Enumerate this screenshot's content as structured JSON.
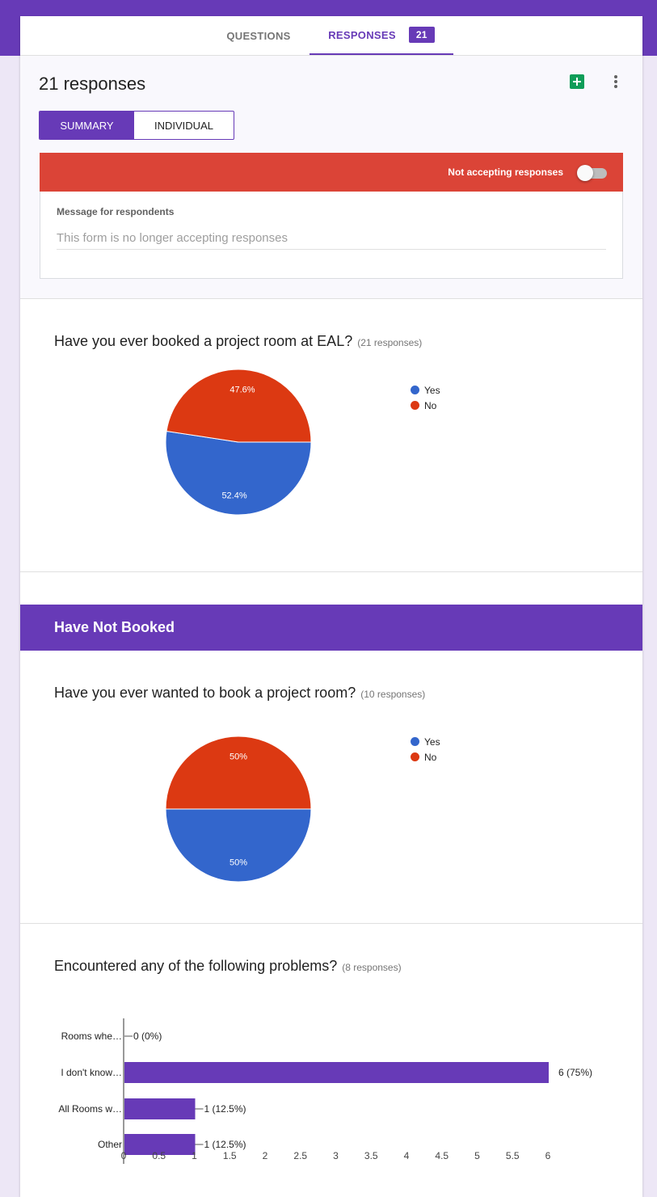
{
  "tabs": {
    "questions": "QUESTIONS",
    "responses": "RESPONSES",
    "responses_count": "21"
  },
  "summary": {
    "title": "21 responses",
    "view_summary": "SUMMARY",
    "view_individual": "INDIVIDUAL",
    "accepting_label": "Not accepting responses",
    "accepting": false,
    "message_label": "Message for respondents",
    "message_value": "This form is no longer accepting responses"
  },
  "colors": {
    "primary": "#673ab7",
    "banner": "#db4437",
    "yes": "#3366cc",
    "no": "#dc3912",
    "sheets": "#0f9d58"
  },
  "icons": {
    "sheets": "sheets-icon",
    "more": "more-vert-icon"
  },
  "section": {
    "title": "Have Not Booked"
  },
  "questions": [
    {
      "title": "Have you ever booked a project room at EAL?",
      "count": "(21 responses)"
    },
    {
      "title": "Have you ever wanted to book a project room?",
      "count": "(10 responses)"
    },
    {
      "title": "Encountered any of the following problems?",
      "count": "(8 responses)"
    }
  ],
  "chart_data": [
    {
      "type": "pie",
      "categories": [
        "Yes",
        "No"
      ],
      "values": [
        52.4,
        47.6
      ],
      "labels": [
        "52.4%",
        "47.6%"
      ],
      "legend": "right"
    },
    {
      "type": "pie",
      "categories": [
        "Yes",
        "No"
      ],
      "values": [
        50,
        50
      ],
      "labels": [
        "50%",
        "50%"
      ],
      "legend": "right"
    },
    {
      "type": "bar",
      "orientation": "horizontal",
      "categories": [
        "Rooms whe…",
        "I don't know…",
        "All Rooms w…",
        "Other"
      ],
      "values": [
        0,
        6,
        1,
        1
      ],
      "labels": [
        "0 (0%)",
        "6 (75%)",
        "1 (12.5%)",
        "1 (12.5%)"
      ],
      "xlim": [
        0,
        6
      ],
      "ticks": [
        "0",
        "0.5",
        "1",
        "1.5",
        "2",
        "2.5",
        "3",
        "3.5",
        "4",
        "4.5",
        "5",
        "5.5",
        "6"
      ],
      "grid": false
    }
  ]
}
